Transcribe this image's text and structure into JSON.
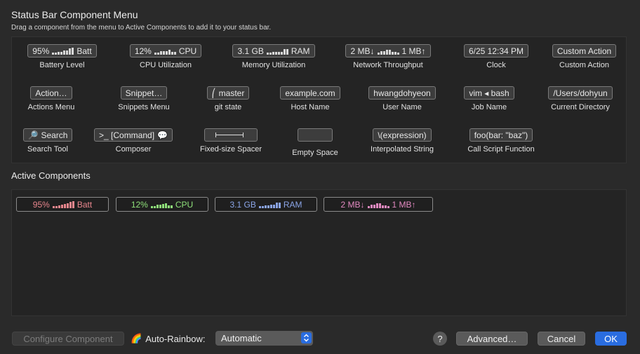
{
  "header": {
    "title": "Status Bar Component Menu",
    "subtitle": "Drag a component from the menu to Active Components to add it to your status bar."
  },
  "palette": [
    {
      "pill": "95%",
      "suffix": "Batt",
      "label": "Battery Level"
    },
    {
      "pill": "12%",
      "suffix": "CPU",
      "label": "CPU Utilization"
    },
    {
      "pill": "3.1 GB",
      "suffix": "RAM",
      "label": "Memory Utilization"
    },
    {
      "pill": "2 MB↓",
      "suffix": "1 MB↑",
      "label": "Network Throughput"
    },
    {
      "pill": "6/25 12:34 PM",
      "label": "Clock"
    },
    {
      "pill": "Custom Action",
      "label": "Custom Action"
    },
    {
      "pill": "Action…",
      "label": "Actions Menu"
    },
    {
      "pill": "Snippet…",
      "label": "Snippets Menu"
    },
    {
      "pill": "master",
      "label": "git state"
    },
    {
      "pill": "example.com",
      "label": "Host Name"
    },
    {
      "pill": "hwangdohyeon",
      "label": "User Name"
    },
    {
      "pill": "vim ◂ bash",
      "label": "Job Name"
    },
    {
      "pill": "/Users/dohyun",
      "label": "Current Directory"
    },
    {
      "pill": "Search",
      "label": "Search Tool"
    },
    {
      "pill": ">_ [Command]",
      "label": "Composer"
    },
    {
      "pill": "",
      "label": "Fixed-size Spacer"
    },
    {
      "pill": "",
      "label": "Empty Space"
    },
    {
      "pill": "\\(expression)",
      "label": "Interpolated String"
    },
    {
      "pill": "foo(bar: \"baz\")",
      "label": "Call Script Function"
    }
  ],
  "active_title": "Active Components",
  "active": [
    {
      "value": "95%",
      "suffix": "Batt",
      "color": "#e8868d"
    },
    {
      "value": "12%",
      "suffix": "CPU",
      "color": "#8fe27a"
    },
    {
      "value": "3.1 GB",
      "suffix": "RAM",
      "color": "#8aa4e6"
    },
    {
      "value": "2 MB↓",
      "suffix": "1 MB↑",
      "color": "#e289c0"
    }
  ],
  "footer": {
    "configure": "Configure Component",
    "rainbow_label": "Auto-Rainbow:",
    "rainbow_value": "Automatic",
    "help": "?",
    "advanced": "Advanced…",
    "cancel": "Cancel",
    "ok": "OK"
  },
  "colors": {
    "accent": "#2a6de0"
  }
}
